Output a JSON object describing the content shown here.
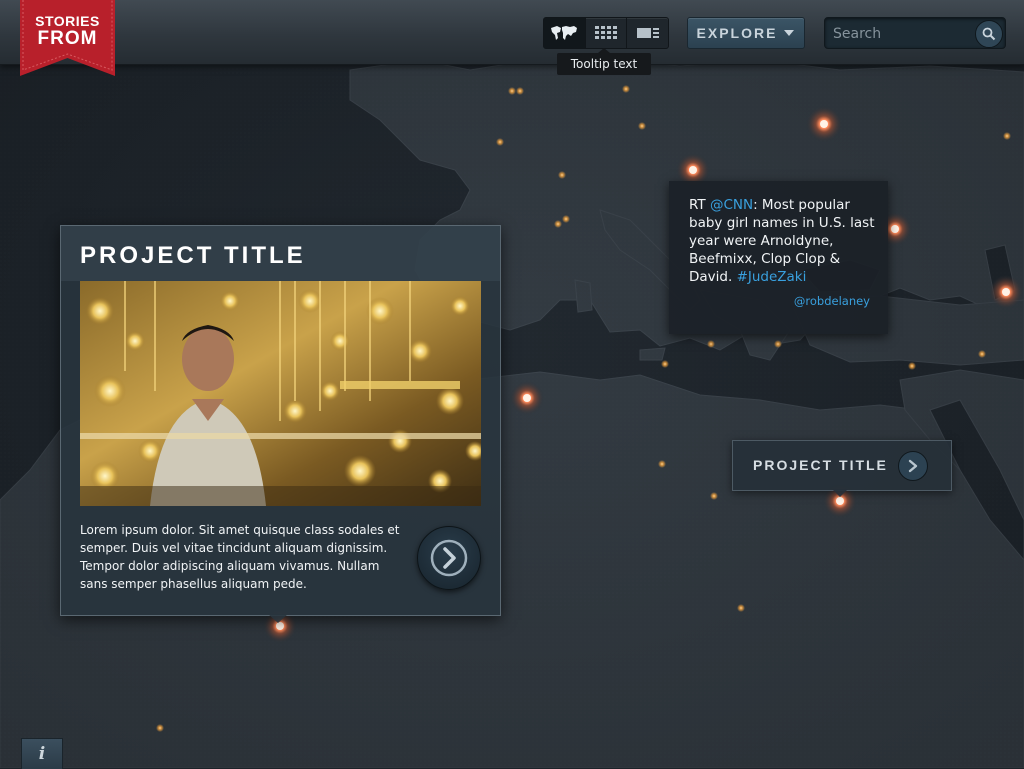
{
  "app": {
    "logo_line1": "STORIES",
    "logo_line2": "FROM",
    "brand_color": "#b8202b"
  },
  "toolbar": {
    "view_switch": [
      {
        "icon": "world-map-icon",
        "active": true
      },
      {
        "icon": "grid-icon",
        "active": false
      },
      {
        "icon": "list-icon",
        "active": false
      }
    ],
    "tooltip": "Tooltip text",
    "explore_label": "EXPLORE",
    "search_placeholder": "Search"
  },
  "project_card": {
    "title": "PROJECT TITLE",
    "image": "photo of a man in a gold jewelry market stall",
    "description": "Lorem ipsum dolor. Sit amet quisque class sodales et semper. Duis vel vitae tincidunt aliquam dignissim. Tempor dolor adipiscing aliquam vivamus. Nullam sans semper phasellus aliquam pede."
  },
  "tweet": {
    "prefix": "RT ",
    "mention": "@CNN",
    "text": ": Most popular baby girl names in U.S. last year were Arnoldyne, Beefmixx, Clop Clop & David. ",
    "hashtag": "#JudeZaki",
    "handle": "@robdelaney",
    "link_color": "#39a0de"
  },
  "callout": {
    "title": "PROJECT TITLE"
  },
  "info_button": {
    "label": "i"
  }
}
